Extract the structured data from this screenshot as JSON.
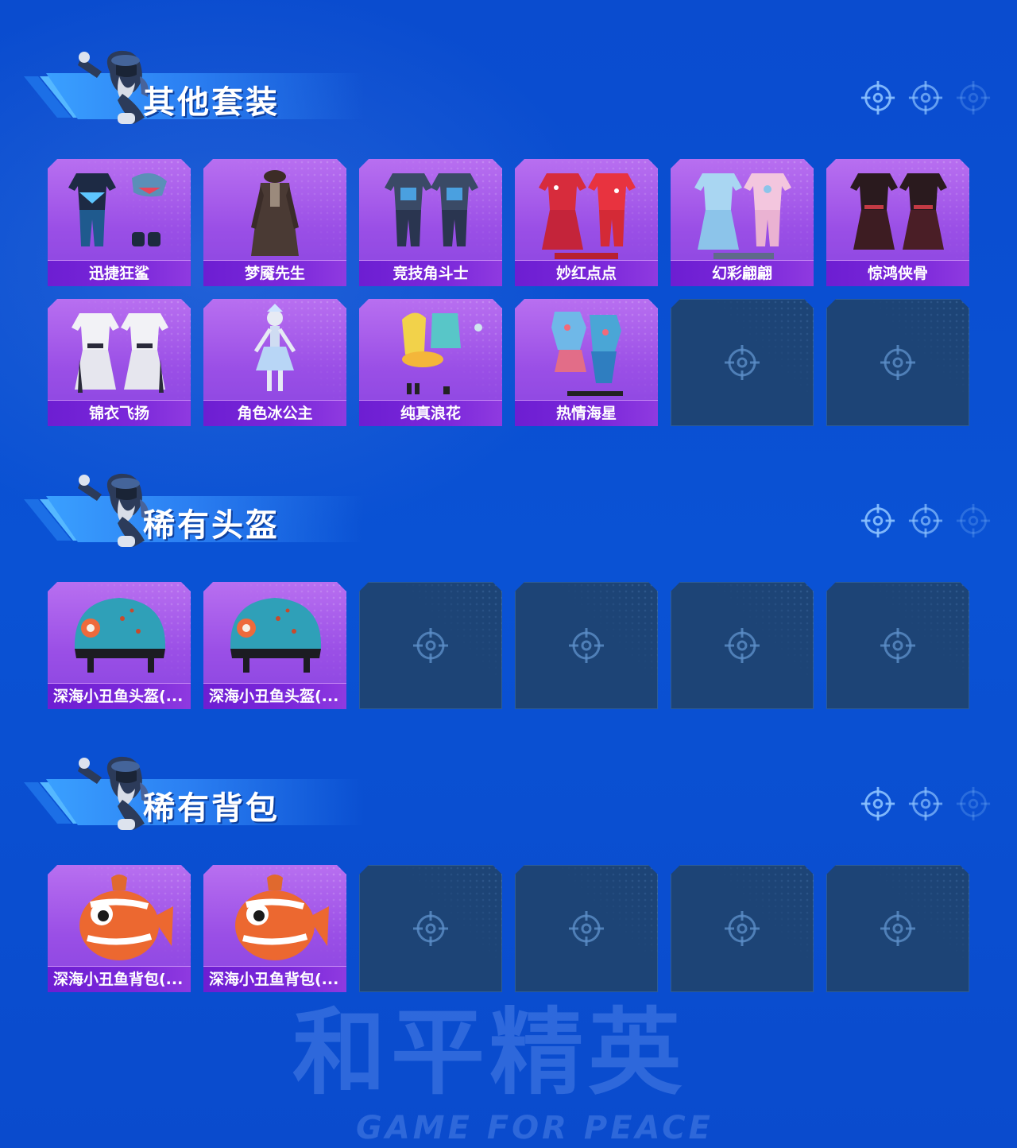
{
  "sections": [
    {
      "title": "其他套装",
      "items": [
        {
          "label": "迅捷狂鲨",
          "art": "shark-outfit"
        },
        {
          "label": "梦魇先生",
          "art": "coat-outfit"
        },
        {
          "label": "竞技角斗士",
          "art": "armor-outfit"
        },
        {
          "label": "妙红点点",
          "art": "red-dress-outfit"
        },
        {
          "label": "幻彩翩翩",
          "art": "pastel-dress-outfit"
        },
        {
          "label": "惊鸿侠骨",
          "art": "black-robe-outfit"
        },
        {
          "label": "锦衣飞扬",
          "art": "white-robe-outfit"
        },
        {
          "label": "角色冰公主",
          "art": "ice-princess-character"
        },
        {
          "label": "纯真浪花",
          "art": "duck-outfit"
        },
        {
          "label": "热情海星",
          "art": "starfish-outfit"
        }
      ],
      "empty_slots": 2
    },
    {
      "title": "稀有头盔",
      "items": [
        {
          "label": "深海小丑鱼头盔(...",
          "art": "clownfish-helmet"
        },
        {
          "label": "深海小丑鱼头盔(...",
          "art": "clownfish-helmet"
        }
      ],
      "empty_slots": 4
    },
    {
      "title": "稀有背包",
      "items": [
        {
          "label": "深海小丑鱼背包(...",
          "art": "clownfish-backpack"
        },
        {
          "label": "深海小丑鱼背包(...",
          "art": "clownfish-backpack"
        }
      ],
      "empty_slots": 4
    }
  ],
  "watermark": {
    "cn": "和平精英",
    "en": "GAME FOR PEACE"
  },
  "colors": {
    "background": "#0b4fd0",
    "card": "#9a4fe6",
    "label_bar": "#7b28da",
    "empty_card": "#1d4476"
  }
}
